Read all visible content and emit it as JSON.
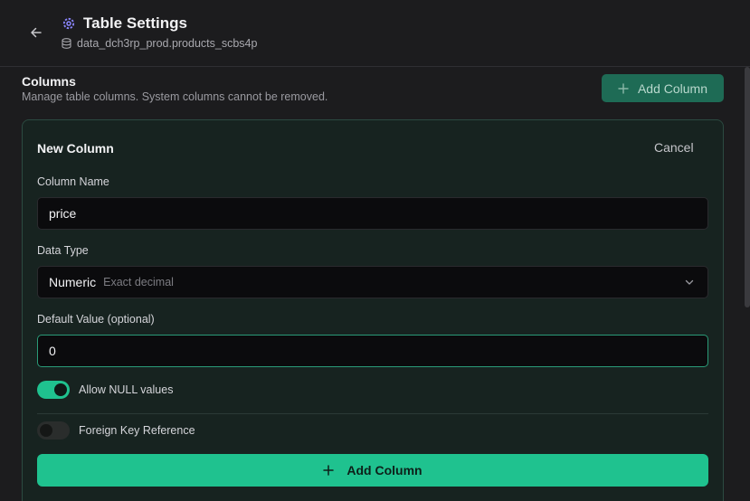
{
  "header": {
    "title": "Table Settings",
    "table_path": "data_dch3rp_prod.products_scbs4p",
    "icons": {
      "back": "arrow-left-icon",
      "title": "gear-icon",
      "path": "database-icon"
    }
  },
  "section": {
    "title": "Columns",
    "description": "Manage table columns. System columns cannot be removed.",
    "add_column_label": "Add Column"
  },
  "form": {
    "title": "New Column",
    "cancel_label": "Cancel",
    "column_name": {
      "label": "Column Name",
      "value": "price"
    },
    "data_type": {
      "label": "Data Type",
      "value": "Numeric",
      "hint": "Exact decimal"
    },
    "default_value": {
      "label": "Default Value (optional)",
      "value": "0"
    },
    "allow_null": {
      "label": "Allow NULL values",
      "enabled": true
    },
    "foreign_key": {
      "label": "Foreign Key Reference",
      "enabled": false
    },
    "submit_label": "Add Column"
  },
  "colors": {
    "accent": "#1fc28f",
    "accent_muted": "#1e6b55",
    "background": "#1c1c1e",
    "card_background": "#172320",
    "card_border": "#2b4a41"
  }
}
